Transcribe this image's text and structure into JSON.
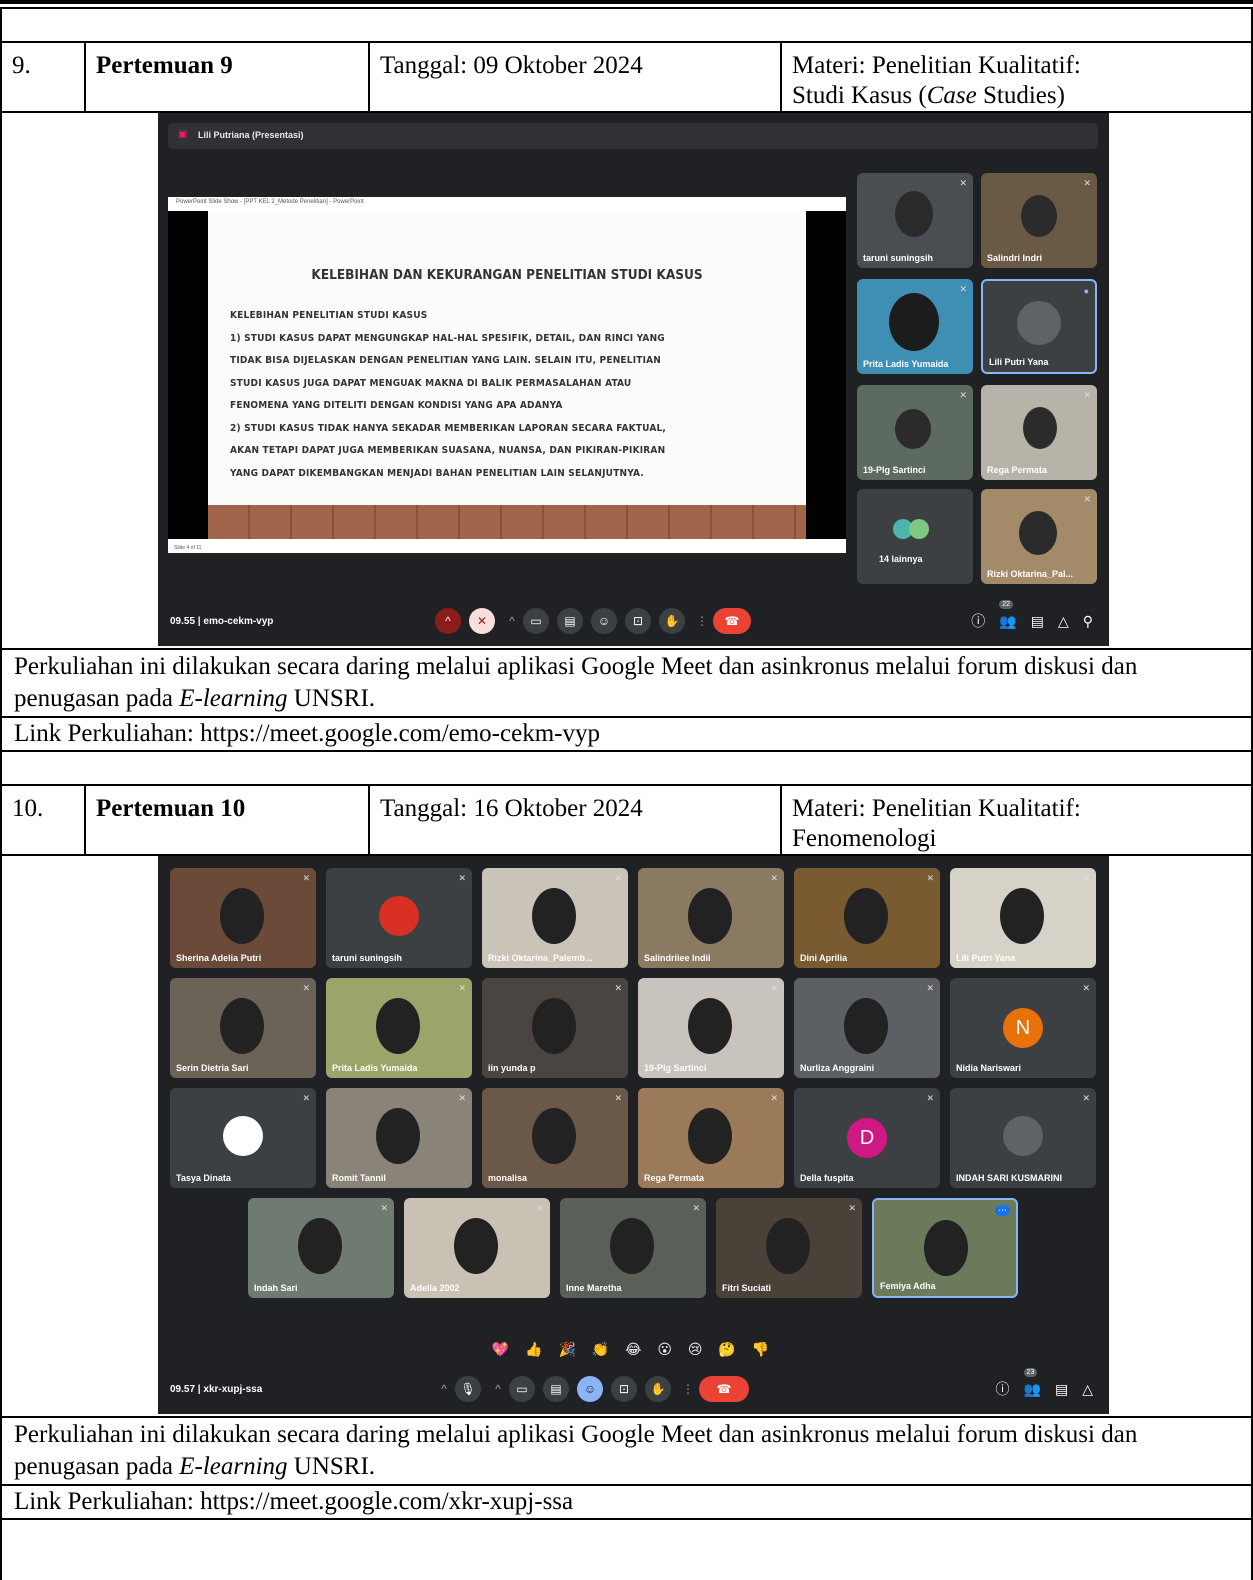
{
  "sessions": [
    {
      "number": "9.",
      "title": "Pertemuan 9",
      "date": "Tanggal: 09 Oktober 2024",
      "topic_line1": "Materi: Penelitian Kualitatif:",
      "topic_line2_pre": "Studi Kasus (",
      "topic_line2_em": "Case",
      "topic_line2_post": " Studies)",
      "description_pre": "Perkuliahan ini dilakukan secara daring melalui aplikasi Google Meet dan asinkronus melalui forum diskusi dan penugasan pada ",
      "description_em": "E-learning",
      "description_post": " UNSRI.",
      "link": "Link Perkuliahan: https://meet.google.com/emo-cekm-vyp",
      "meet": {
        "presenter": "Lili Putriana (Presentasi)",
        "window_title": "PowerPoint Slide Show - [PPT KEL 2_Metode Penelitian] - PowerPoint",
        "slide_heading": "KELEBIHAN DAN KEKURANGAN PENELITIAN STUDI KASUS",
        "slide_lines": [
          "KELEBIHAN PENELITIAN STUDI KASUS",
          "1) STUDI KASUS DAPAT MENGUNGKAP HAL-HAL SPESIFIK, DETAIL, DAN RINCI YANG",
          "TIDAK BISA DIJELASKAN DENGAN PENELITIAN YANG LAIN. SELAIN ITU, PENELITIAN",
          "STUDI KASUS JUGA DAPAT MENGUAK MAKNA DI BALIK PERMASALAHAN ATAU",
          "FENOMENA YANG DITELITI DENGAN KONDISI YANG APA ADANYA",
          "2) STUDI KASUS TIDAK HANYA SEKADAR MEMBERIKAN LAPORAN SECARA FAKTUAL,",
          "AKAN TETAPI DAPAT JUGA MEMBERIKAN SUASANA, NUANSA, DAN PIKIRAN-PIKIRAN",
          "YANG DAPAT DIKEMBANGKAN MENJADI BAHAN PENELITIAN LAIN SELANJUTNYA."
        ],
        "slide_footer": "Slide 4 of 11",
        "participants": [
          "taruni suningsih",
          "Salindri Indri",
          "Prita Ladis Yumaida",
          "Lili Putri Yana",
          "19-Plg Sartinci",
          "Rega Permata",
          "14 lainnya",
          "Rizki Oktarina_Pal..."
        ],
        "time_code": "09.55  |  emo-cekm-vyp",
        "participant_count": "22"
      }
    },
    {
      "number": "10.",
      "title": "Pertemuan 10",
      "date": "Tanggal: 16 Oktober 2024",
      "topic_line1": "Materi: Penelitian Kualitatif:",
      "topic_line2": "Fenomenologi",
      "description_pre": "Perkuliahan ini dilakukan secara daring melalui aplikasi Google Meet dan asinkronus melalui forum diskusi dan penugasan pada ",
      "description_em": "E-learning",
      "description_post": " UNSRI.",
      "link": "Link Perkuliahan: https://meet.google.com/xkr-xupj-ssa",
      "meet": {
        "participants": [
          "Sherina Adelia Putri",
          "taruni suningsih",
          "Rizki Oktarina_Palemb...",
          "Salindriiee Indii",
          "Dini Aprilia",
          "Lili Putri Yana",
          "Serin Dietria Sari",
          "Prita Ladis Yumaida",
          "iin yunda p",
          "19-Plg Sartinci",
          "Nurliza Anggraini",
          "Nidia Nariswari",
          "Tasya Dinata",
          "Romit Tannil",
          "monalisa",
          "Rega Permata",
          "Della fuspita",
          "INDAH SARI KUSMARINI",
          "Indah Sari",
          "Adelia 2002",
          "Inne Maretha",
          "Fitri Suciati",
          "Femiya Adha"
        ],
        "initial_N": "N",
        "initial_D": "D",
        "reactions": "💖 👍 🎉 👏 😂 😮 😢 🤔 👎",
        "time_code": "09.57  |  xkr-xupj-ssa",
        "participant_count": "23"
      }
    }
  ]
}
